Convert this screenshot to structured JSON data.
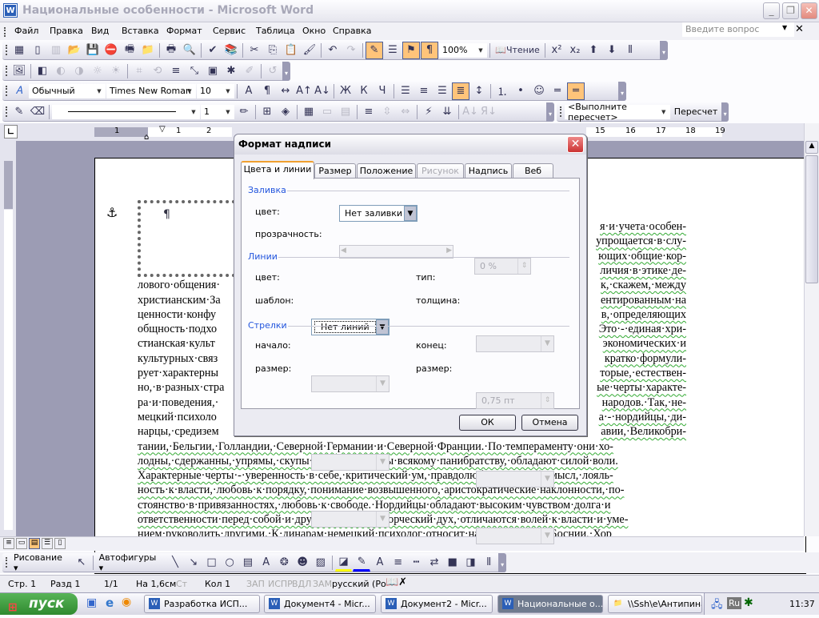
{
  "window": {
    "title": "Национальные особенности - Microsoft Word",
    "app_icon": "word-icon"
  },
  "menu": [
    "Файл",
    "Правка",
    "Вид",
    "Вставка",
    "Формат",
    "Сервис",
    "Таблица",
    "Окно",
    "Справка"
  ],
  "help": {
    "placeholder": "Введите вопрос"
  },
  "toolbar1": {
    "icons": [
      "table-icon",
      "new-icon",
      "open-book-icon",
      "open-icon",
      "save-icon",
      "permission-icon",
      "print-fax-icon",
      "folder-icon",
      "|",
      "print-icon",
      "print-preview-icon",
      "|",
      "spelling-icon",
      "research-icon",
      "|",
      "cut-icon",
      "copy-icon",
      "paste-icon",
      "format-painter-icon",
      "|",
      "undo-icon",
      "redo-icon",
      "|",
      "drawing-toggle-icon",
      "document-map-icon",
      "show-formatting-icon",
      "pilcrow-icon"
    ],
    "zoom": "100%",
    "read_label": "Чтение",
    "extra": [
      "superscript-icon",
      "subscript-icon",
      "up-arrow-icon",
      "down-arrow-icon",
      "columns-icon"
    ]
  },
  "toolbar2": {
    "icons": [
      "insert-picture-icon",
      "|",
      "color-icon",
      "more-contrast-icon",
      "less-contrast-icon",
      "more-brightness-icon",
      "less-brightness-icon",
      "|",
      "crop-icon",
      "rotate-icon",
      "line-style-icon",
      "compress-icon",
      "text-wrap-icon",
      "format-picture-icon",
      "set-transparent-icon",
      "|",
      "reset-picture-icon"
    ]
  },
  "toolbar3": {
    "style": "Обычный",
    "font": "Times New Roman",
    "size": "10",
    "icons": [
      "font-color-a-icon",
      "paragraph-icon",
      "char-scale-icon",
      "grow-font-icon",
      "shrink-font-icon",
      "|",
      "bold-icon",
      "italic-icon",
      "underline-icon",
      "|",
      "align-left-icon",
      "align-center-icon",
      "align-right-icon",
      "justify-icon",
      "line-spacing-icon",
      "|",
      "numbering-icon",
      "bullets-icon",
      "smiley-icon",
      "equal-icon",
      "highlight-line-icon"
    ]
  },
  "toolbar4": {
    "line_weight": "1",
    "icons": [
      "draw-table-icon",
      "eraser-icon"
    ],
    "icons2": [
      "pen-color-icon",
      "|",
      "borders-icon",
      "shading-icon",
      "|",
      "insert-table-icon",
      "merge-cells-icon",
      "split-cells-icon",
      "|",
      "align-icon",
      "distribute-rows-icon",
      "distribute-cols-icon",
      "|",
      "autoformat-icon",
      "text-direction-icon",
      "|",
      "sort-asc-icon",
      "sort-desc-icon"
    ],
    "recalc_combo": "<Выполните пересчет>",
    "recalc_button": "Пересчет"
  },
  "ruler": {
    "labels": [
      "1",
      "1",
      "2",
      "15",
      "16",
      "17",
      "18",
      "19"
    ]
  },
  "document": {
    "lines": [
      {
        "l": "",
        "r": "я·и·учета·особен-"
      },
      {
        "l": "",
        "r": "упрощается·в·слу-"
      },
      {
        "l": "",
        "r": "ющих·общие·кор-"
      },
      {
        "l": "",
        "r": "личия·в·этике·де-"
      },
      {
        "l": "лового·общения·",
        "r": "к,·скажем,·между"
      },
      {
        "l": "христианским·За",
        "r": "ентированным·на"
      },
      {
        "l": "ценности·конфу",
        "r": "в,·определяющих"
      },
      {
        "l": "общность·подхо",
        "r": "Это·-·единая·хри-"
      },
      {
        "l": "стианская·культ",
        "r": "экономических·и"
      },
      {
        "l": "культурных·связ",
        "r": "кратко·формули-"
      },
      {
        "l": "рует·характерны",
        "r": "торые,·естествен-"
      },
      {
        "l": "но,·в·разных·стра",
        "r": "ые·черты·характе-"
      },
      {
        "l": "ра·и·поведения,·",
        "r": "народов.·Так,·не-"
      },
      {
        "l": "мецкий·психоло",
        "r": "а·-·нордийцы,·ди-"
      },
      {
        "l": "нарцы,·средизем",
        "r": "авии,·Великобри-"
      }
    ],
    "full_lines": [
      "тании,·Бельгии,·Голландии,·Северной·Германии·и·Северной·Франции.·По·темпераменту·они·хо-",
      "лодны,·сдержанны,·упрямы,·скупы·на·слова,·чужды·всякому·панибратству,·обладают·силой·воли.",
      "Характерные·черты·-·уверенность·в·себе,·критический·ум,·правдолюбие,·здравый·смысл,·лояль-",
      "ность·к·власти,·любовь·к·порядку,·понимание·возвышенного,·аристократические·наклонности,·по-",
      "стоянство·в·привязанностях,·любовь·к·свободе.·Нордийцы·обладают·высоким·чувством·долга·и",
      "ответственности·перед·собой·и·другими,·имеют·творческий·дух,·отличаются·волей·к·власти·и·уме-",
      "нием·руководить·другими.·К·динарам·немецкий·психолог·относит·народы·Сербии,·Боснии,·Хор"
    ],
    "textbox_mark": "¶"
  },
  "dialog": {
    "title": "Формат надписи",
    "tabs": [
      {
        "label": "Цвета и линии",
        "state": "selected"
      },
      {
        "label": "Размер"
      },
      {
        "label": "Положение"
      },
      {
        "label": "Рисунок",
        "state": "disabled"
      },
      {
        "label": "Надпись"
      },
      {
        "label": "Веб"
      }
    ],
    "fill": {
      "title": "Заливка",
      "color_label": "цвет:",
      "color_value": "Нет заливки",
      "transparency_label": "прозрачность:",
      "transparency_value": "0 %"
    },
    "lines": {
      "title": "Линии",
      "color_label": "цвет:",
      "color_value": "Нет линий",
      "type_label": "тип:",
      "pattern_label": "шаблон:",
      "weight_label": "толщина:",
      "weight_value": "0,75 пт"
    },
    "arrows": {
      "title": "Стрелки",
      "begin_label": "начало:",
      "end_label": "конец:",
      "begin_size_label": "размер:",
      "end_size_label": "размер:"
    },
    "ok": "ОК",
    "cancel": "Отмена"
  },
  "drawing": {
    "label": "Рисование",
    "autoshapes": "Автофигуры",
    "icons": [
      "line-icon",
      "arrow-icon",
      "rectangle-icon",
      "oval-icon",
      "textbox-icon",
      "wordart-icon",
      "diagram-icon",
      "clipart-icon",
      "picture-icon",
      "|",
      "fill-color-icon",
      "line-color-icon",
      "font-color-icon",
      "line-style-icon",
      "dash-style-icon",
      "arrow-style-icon",
      "shadow-icon",
      "3d-icon",
      "columns-icon"
    ],
    "fill_color": "#ffff00",
    "line_color": "#0000ff"
  },
  "status": {
    "page": "Стр. 1",
    "section": "Разд 1",
    "pages": "1/1",
    "at": "На 1,6см",
    "line": "Ст",
    "col": "Кол 1",
    "rec": "ЗАП",
    "trk": "ИСПР",
    "ext": "ВДЛ",
    "ovr": "ЗАМ",
    "lang": "русский (Ро"
  },
  "taskbar": {
    "start": "пуск",
    "tasks": [
      {
        "label": "Разработка ИСП..."
      },
      {
        "label": "Документ4 - Micr..."
      },
      {
        "label": "Документ2 - Micr..."
      },
      {
        "label": "Национальные о...",
        "active": true
      },
      {
        "label": "\\\\Ssh\\e\\Антипина..."
      }
    ],
    "lang": "Ru",
    "clock": "11:37"
  }
}
